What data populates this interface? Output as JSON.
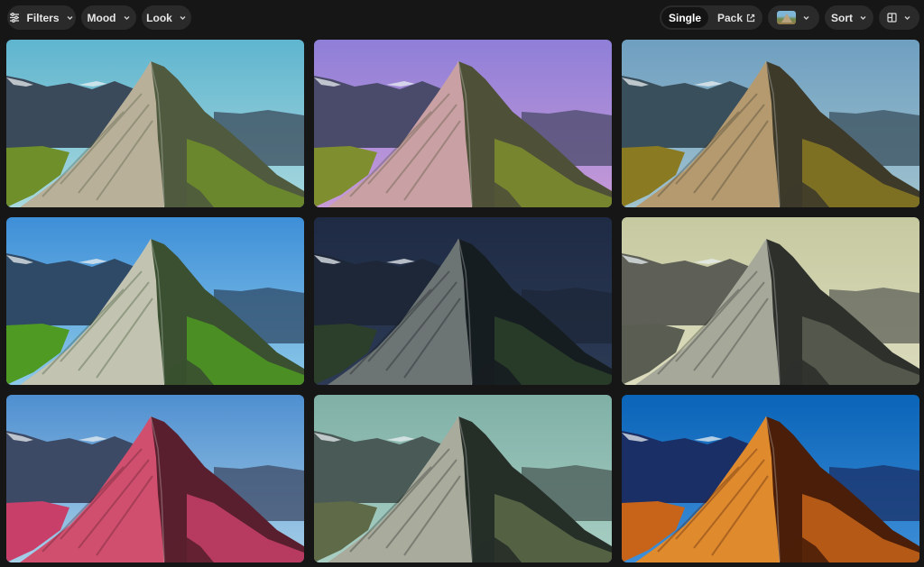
{
  "toolbar": {
    "filters_label": "Filters",
    "mood_label": "Mood",
    "look_label": "Look",
    "view_single_label": "Single",
    "view_pack_label": "Pack",
    "sort_label": "Sort",
    "icons": {
      "filters": "sliders-icon",
      "chevron": "chevron-down-icon",
      "external": "external-link-icon",
      "layout": "grid-layout-icon"
    }
  },
  "grid": {
    "tiles": [
      {
        "sky_top": "#5fb5cf",
        "sky_bottom": "#a8d8de",
        "rock": "#b9b09a",
        "shade": "#4f5a3e",
        "grass": "#6f8f2a",
        "ridge": "#3a4a5a",
        "overlay": "none"
      },
      {
        "sky_top": "#8f7fd8",
        "sky_bottom": "#c79ad8",
        "rock": "#c9a0a4",
        "shade": "#4f5038",
        "grass": "#7f8e2e",
        "ridge": "#4a4a6a",
        "overlay": "none"
      },
      {
        "sky_top": "#6f9fc0",
        "sky_bottom": "#9fc2cf",
        "rock": "#b59a6f",
        "shade": "#3d3a2a",
        "grass": "#8a7a22",
        "ridge": "#3a4f5c",
        "overlay": "none"
      },
      {
        "sky_top": "#3e8fd8",
        "sky_bottom": "#8cc8e8",
        "rock": "#c2c3b0",
        "shade": "#3a5030",
        "grass": "#4f9a22",
        "ridge": "#2f4a66",
        "overlay": "none"
      },
      {
        "sky_top": "#1f2b44",
        "sky_bottom": "#2c3a55",
        "rock": "#6d7474",
        "shade": "#161d20",
        "grass": "#2c3f2a",
        "ridge": "#1d2738",
        "overlay": "none"
      },
      {
        "sky_top": "#c6c9a0",
        "sky_bottom": "#dcdcbe",
        "rock": "#a6a89a",
        "shade": "#2e302c",
        "grass": "#5a5e52",
        "ridge": "#5e6058",
        "overlay": "none"
      },
      {
        "sky_top": "#4f8fd0",
        "sky_bottom": "#a6cfe8",
        "rock": "#d04f6e",
        "shade": "#5a1f2e",
        "grass": "#c8406a",
        "ridge": "#3d4a66",
        "overlay": "none"
      },
      {
        "sky_top": "#7fb0a6",
        "sky_bottom": "#a9cfc4",
        "rock": "#a9ab9c",
        "shade": "#262e28",
        "grass": "#5e6a48",
        "ridge": "#4a5a56",
        "overlay": "none"
      },
      {
        "sky_top": "#0a64b8",
        "sky_bottom": "#3f8fd8",
        "rock": "#e08a2e",
        "shade": "#4a1e08",
        "grass": "#c8641a",
        "ridge": "#1a2f66",
        "overlay": "none"
      }
    ]
  }
}
